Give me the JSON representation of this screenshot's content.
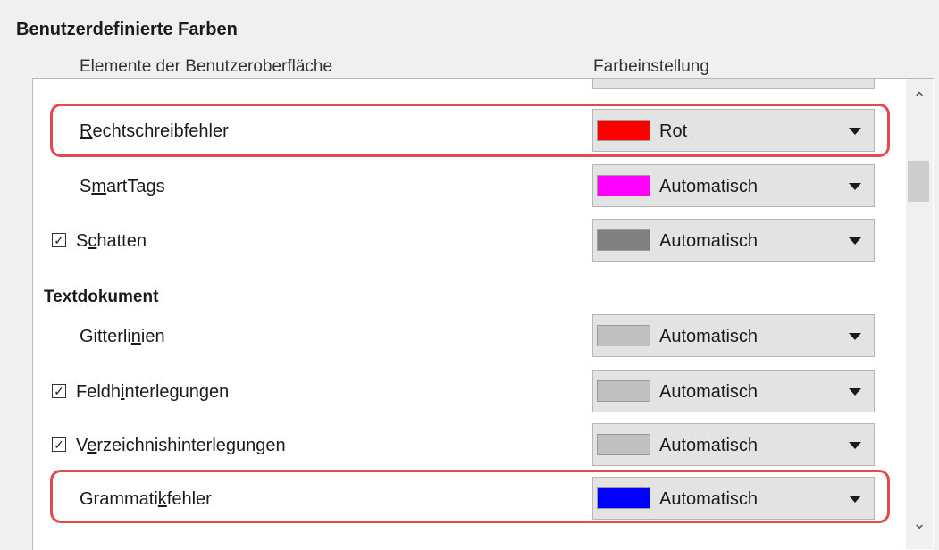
{
  "section_title": "Benutzerdefinierte Farben",
  "headers": {
    "elements": "Elemente der Benutzeroberfläche",
    "color_setting": "Farbeinstellung"
  },
  "rows": [
    {
      "name": "Rechtschreibfehler",
      "pre": "",
      "acc": "R",
      "post": "echtschreibfehler",
      "checkbox": false,
      "color": "#ff0000",
      "value": "Rot"
    },
    {
      "name": "SmartTags",
      "pre": "S",
      "acc": "m",
      "post": "artTags",
      "checkbox": false,
      "color": "#ff00ff",
      "value": "Automatisch"
    },
    {
      "name": "Schatten",
      "pre": "S",
      "acc": "c",
      "post": "hatten",
      "checkbox": true,
      "color": "#808080",
      "value": "Automatisch"
    },
    {
      "group": "Textdokument"
    },
    {
      "name": "Gitterlinien",
      "pre": "Gitterli",
      "acc": "n",
      "post": "ien",
      "checkbox": false,
      "color": "#c0c0c0",
      "value": "Automatisch"
    },
    {
      "name": "Feldhinterlegungen",
      "pre": "Feldh",
      "acc": "i",
      "post": "nterlegungen",
      "checkbox": true,
      "color": "#c0c0c0",
      "value": "Automatisch"
    },
    {
      "name": "Verzeichnishinterlegungen",
      "pre": "V",
      "acc": "e",
      "post": "rzeichnishinterlegungen",
      "checkbox": true,
      "color": "#c0c0c0",
      "value": "Automatisch"
    },
    {
      "name": "Grammatikfehler",
      "pre": "Grammati",
      "acc": "k",
      "post": "fehler",
      "checkbox": false,
      "color": "#0000ff",
      "value": "Automatisch"
    }
  ],
  "partial_top_swatch_color": "#0000cc",
  "checkmark": "☑",
  "scroll_up": "⌃",
  "scroll_down": "⌄"
}
